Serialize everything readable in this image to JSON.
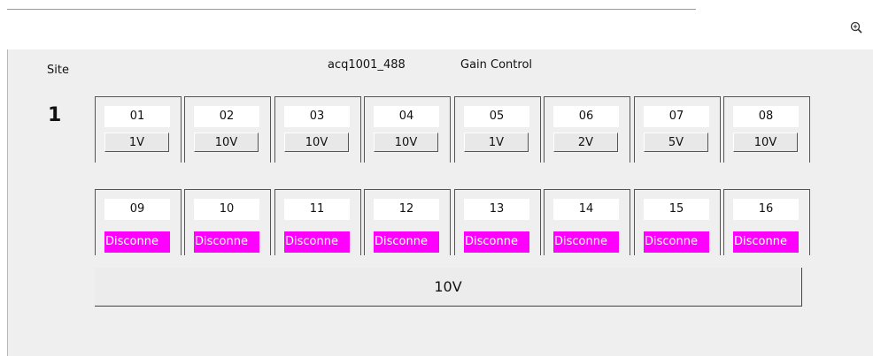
{
  "header": {
    "site_label": "Site",
    "site_number": "1",
    "device": "acq1001_488",
    "title": "Gain Control"
  },
  "channels_top": [
    {
      "num": "01",
      "gain": "1V"
    },
    {
      "num": "02",
      "gain": "10V"
    },
    {
      "num": "03",
      "gain": "10V"
    },
    {
      "num": "04",
      "gain": "10V"
    },
    {
      "num": "05",
      "gain": "1V"
    },
    {
      "num": "06",
      "gain": "2V"
    },
    {
      "num": "07",
      "gain": "5V"
    },
    {
      "num": "08",
      "gain": "10V"
    }
  ],
  "channels_bottom": [
    {
      "num": "09",
      "status": "Disconne"
    },
    {
      "num": "10",
      "status": "Disconne"
    },
    {
      "num": "11",
      "status": "Disconne"
    },
    {
      "num": "12",
      "status": "Disconne"
    },
    {
      "num": "13",
      "status": "Disconne"
    },
    {
      "num": "14",
      "status": "Disconne"
    },
    {
      "num": "15",
      "status": "Disconne"
    },
    {
      "num": "16",
      "status": "Disconne"
    }
  ],
  "all_button": {
    "label": "10V"
  },
  "icons": {
    "zoom": "zoom-in-icon"
  },
  "colors": {
    "disconnected": "#ff00ff"
  }
}
